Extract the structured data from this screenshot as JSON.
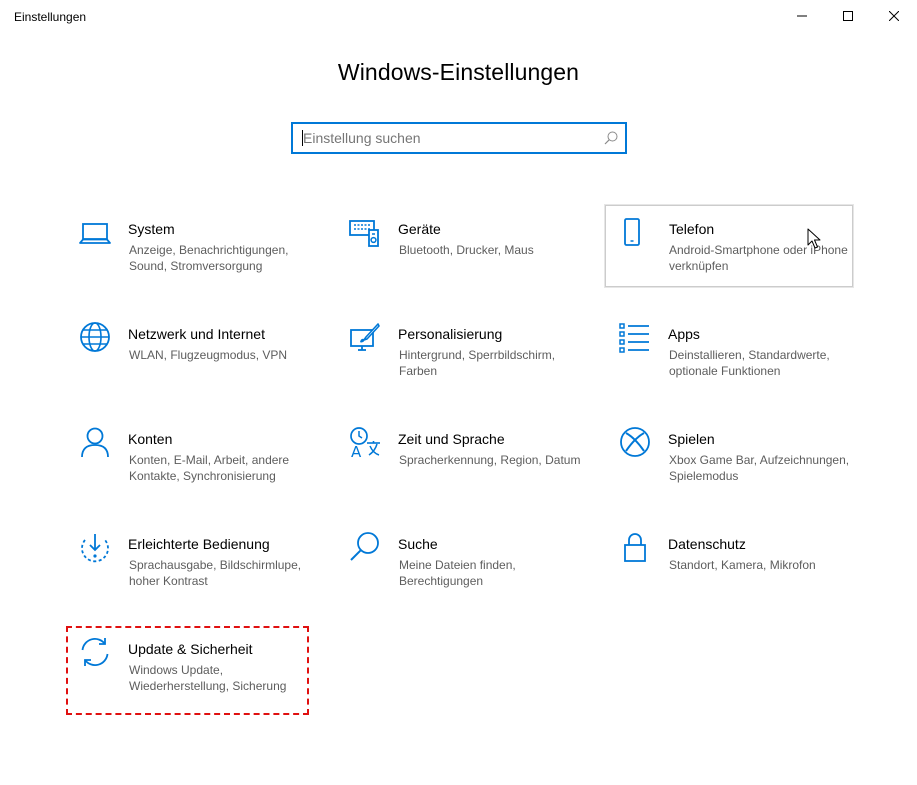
{
  "window": {
    "app_title": "Einstellungen",
    "controls": {
      "minimize": "minimize-icon",
      "maximize": "maximize-icon",
      "close": "close-icon"
    }
  },
  "page": {
    "title": "Windows-Einstellungen"
  },
  "search": {
    "placeholder": "Einstellung suchen",
    "value": ""
  },
  "colors": {
    "accent": "#0078d7",
    "highlight": "#e01010",
    "description_text": "#5d5d5d"
  },
  "tiles": [
    {
      "title": "System",
      "desc": "Anzeige, Benachrichtigungen, Sound, Stromversorgung",
      "icon": "laptop-icon"
    },
    {
      "title": "Geräte",
      "desc": "Bluetooth, Drucker, Maus",
      "icon": "devices-icon"
    },
    {
      "title": "Telefon",
      "desc": "Android-Smartphone oder iPhone verknüpfen",
      "icon": "phone-icon",
      "state": "hovered"
    },
    {
      "title": "Netzwerk und Internet",
      "desc": "WLAN, Flugzeugmodus, VPN",
      "icon": "globe-icon"
    },
    {
      "title": "Personalisierung",
      "desc": "Hintergrund, Sperrbildschirm, Farben",
      "icon": "personalization-icon"
    },
    {
      "title": "Apps",
      "desc": "Deinstallieren, Standardwerte, optionale Funktionen",
      "icon": "apps-list-icon"
    },
    {
      "title": "Konten",
      "desc": "Konten, E-Mail, Arbeit, andere Kontakte, Synchronisierung",
      "icon": "person-icon"
    },
    {
      "title": "Zeit und Sprache",
      "desc": "Spracherkennung, Region, Datum",
      "icon": "time-language-icon"
    },
    {
      "title": "Spielen",
      "desc": "Xbox Game Bar, Aufzeichnungen, Spielemodus",
      "icon": "xbox-icon"
    },
    {
      "title": "Erleichterte Bedienung",
      "desc": "Sprachausgabe, Bildschirmlupe, hoher Kontrast",
      "icon": "ease-of-access-icon"
    },
    {
      "title": "Suche",
      "desc": "Meine Dateien finden, Berechtigungen",
      "icon": "search-icon"
    },
    {
      "title": "Datenschutz",
      "desc": "Standort, Kamera, Mikrofon",
      "icon": "lock-icon"
    },
    {
      "title": "Update & Sicherheit",
      "desc": "Windows Update, Wiederherstellung, Sicherung",
      "icon": "sync-icon",
      "state": "highlighted"
    }
  ]
}
